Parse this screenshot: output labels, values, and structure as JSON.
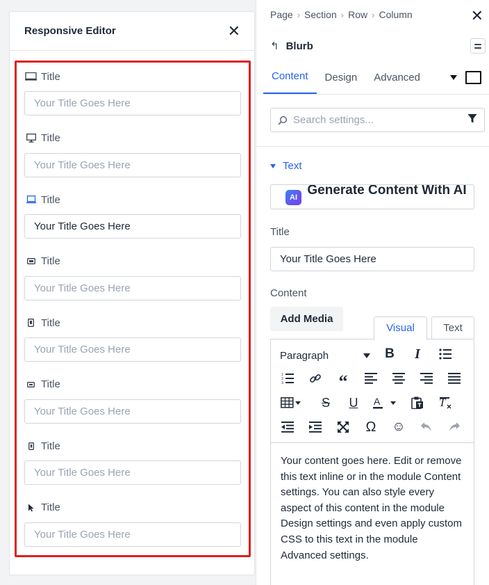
{
  "responsive_editor": {
    "title": "Responsive Editor",
    "fields": [
      {
        "device": "desktop-wide-icon",
        "label": "Title",
        "value": "",
        "placeholder": "Your Title Goes Here"
      },
      {
        "device": "desktop-icon",
        "label": "Title",
        "value": "",
        "placeholder": "Your Title Goes Here"
      },
      {
        "device": "laptop-icon",
        "label": "Title",
        "value": "Your Title Goes Here",
        "placeholder": "Your Title Goes Here"
      },
      {
        "device": "tablet-landscape-icon",
        "label": "Title",
        "value": "",
        "placeholder": "Your Title Goes Here"
      },
      {
        "device": "tablet-portrait-icon",
        "label": "Title",
        "value": "",
        "placeholder": "Your Title Goes Here"
      },
      {
        "device": "phone-landscape-icon",
        "label": "Title",
        "value": "",
        "placeholder": "Your Title Goes Here"
      },
      {
        "device": "phone-portrait-icon",
        "label": "Title",
        "value": "",
        "placeholder": "Your Title Goes Here"
      },
      {
        "device": "hover-cursor-icon",
        "label": "Title",
        "value": "",
        "placeholder": "Your Title Goes Here"
      }
    ]
  },
  "settings": {
    "breadcrumb": [
      "Page",
      "Section",
      "Row",
      "Column"
    ],
    "module_name": "Blurb",
    "tabs": [
      "Content",
      "Design",
      "Advanced"
    ],
    "active_tab": "Content",
    "search_placeholder": "Search settings...",
    "group_title": "Text",
    "ai_badge": "AI",
    "ai_button_label": "Generate Content With AI",
    "title_label": "Title",
    "title_value": "Your Title Goes Here",
    "content_label": "Content",
    "add_media_label": "Add Media",
    "editor_tabs": {
      "visual": "Visual",
      "text": "Text"
    },
    "paragraph_format": "Paragraph",
    "content_text": "Your content goes here. Edit or remove this text inline or in the module Content settings. You can also style every aspect of this content in the module Design settings and even apply custom CSS to this text in the module Advanced settings."
  },
  "colors": {
    "accent": "#2563eb",
    "highlight_border": "#e11d1d"
  }
}
